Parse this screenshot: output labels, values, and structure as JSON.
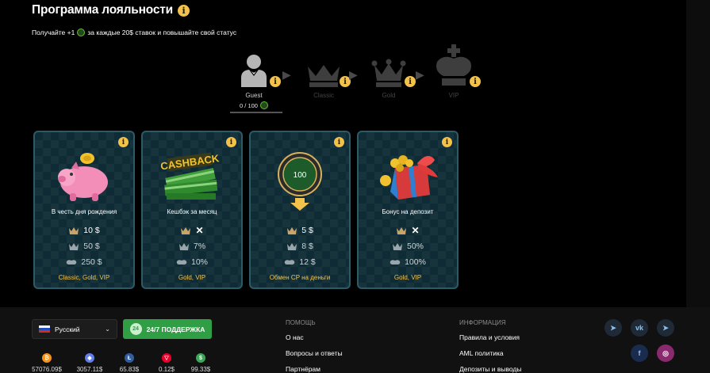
{
  "page": {
    "title": "Программа лояльности",
    "subtitle_pre": "Получайте +1",
    "subtitle_post": "за каждые 20$ ставок и повышайте свой статус"
  },
  "levels": [
    {
      "name": "Guest",
      "progress": "0 / 100",
      "active": true,
      "icon": "person-icon"
    },
    {
      "name": "Classic",
      "active": false,
      "icon": "crown-classic-icon"
    },
    {
      "name": "Gold",
      "active": false,
      "icon": "crown-gold-icon"
    },
    {
      "name": "VIP",
      "active": false,
      "icon": "crown-vip-icon"
    }
  ],
  "cards": [
    {
      "name": "В честь дня рождения",
      "icon": "piggy-bank-icon",
      "rows": [
        "10 $",
        "50 $",
        "250 $"
      ],
      "footer": "Classic, Gold, VIP"
    },
    {
      "name": "Кешбэк за месяц",
      "icon": "cashback-icon",
      "rows": [
        "",
        "7%",
        "10%"
      ],
      "footer": "Gold, VIP"
    },
    {
      "name": "",
      "icon": "chip-100-icon",
      "chip": "100",
      "rows": [
        "5 $",
        "8 $",
        "12 $"
      ],
      "footer": "Обмен CP на деньги"
    },
    {
      "name": "Бонус на депозит",
      "icon": "gift-box-icon",
      "rows": [
        "",
        "50%",
        "100%"
      ],
      "footer": "Gold, VIP"
    }
  ],
  "footer": {
    "language": "Русский",
    "support": "24/7 ПОДДЕРЖКА",
    "col1": {
      "header": "ПОМОЩЬ",
      "links": [
        "О нас",
        "Вопросы и ответы",
        "Партнёрам"
      ]
    },
    "col2": {
      "header": "ИНФОРМАЦИЯ",
      "links": [
        "Правила и условия",
        "AML политика",
        "Депозиты и выводы"
      ]
    },
    "coins": [
      {
        "icon": "bitcoin-icon",
        "value": "57076.09$",
        "color": "#f7931a"
      },
      {
        "icon": "ethereum-icon",
        "value": "3057.11$",
        "color": "#627eea"
      },
      {
        "icon": "litecoin-icon",
        "value": "65.83$",
        "color": "#345d9d"
      },
      {
        "icon": "tron-icon",
        "value": "0.12$",
        "color": "#eb0029"
      },
      {
        "icon": "dollar-icon",
        "value": "99.33$",
        "color": "#3ca757"
      }
    ]
  },
  "colors": {
    "accent": "#f3c24d",
    "card_border": "#2c5a67",
    "support_green": "#2f9e44"
  }
}
